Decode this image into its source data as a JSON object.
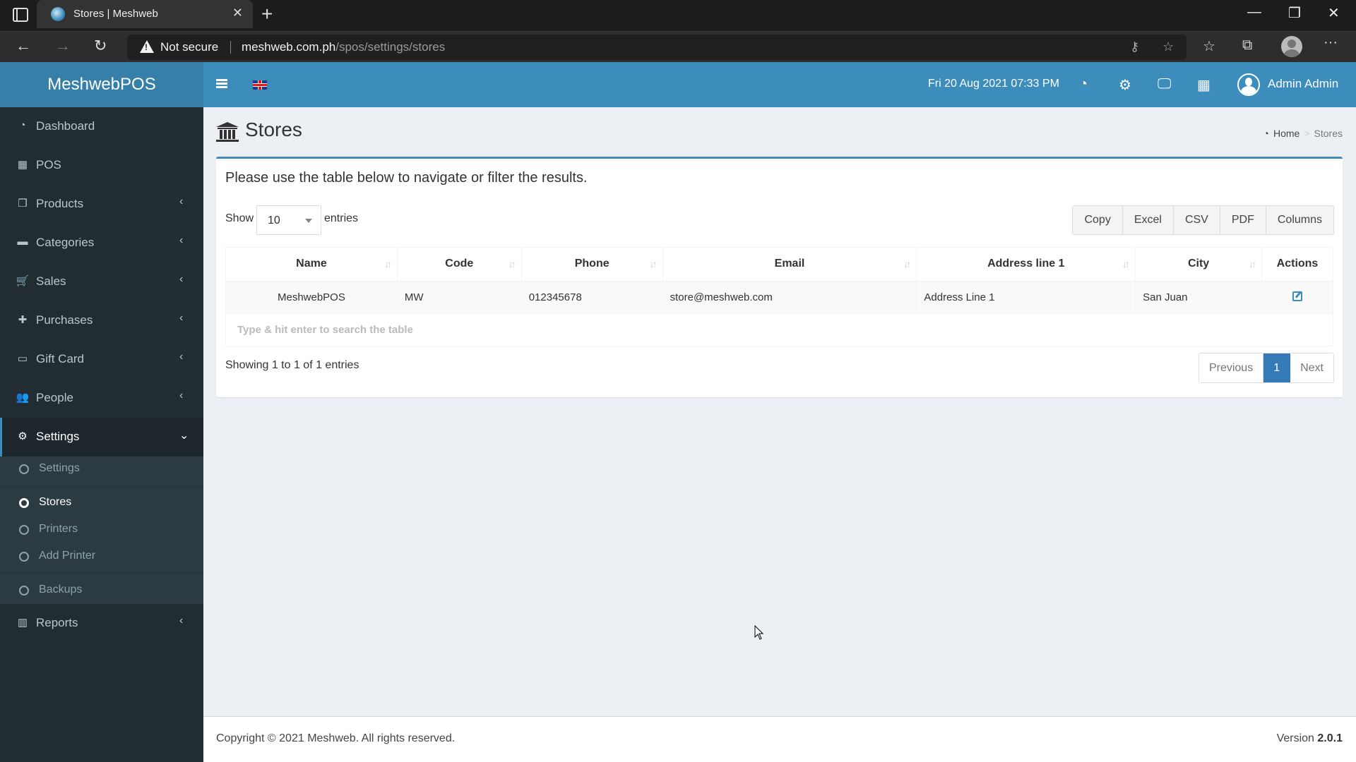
{
  "browser": {
    "tab_title": "Stores | Meshweb",
    "security_label": "Not secure",
    "url_host": "meshweb.com.ph",
    "url_path": "/spos/settings/stores"
  },
  "app": {
    "logo": "MeshwebPOS",
    "datetime": "Fri 20 Aug 2021 07:33 PM",
    "user_name": "Admin Admin",
    "language_flag": "uk-flag",
    "colors": {
      "primary": "#3c8dbc",
      "logo_bg": "#367fa9",
      "sidebar_bg": "#222d32",
      "submenu_bg": "#2c3b41",
      "content_bg": "#ecf0f5",
      "pagination_active": "#337ab7"
    }
  },
  "sidebar": {
    "items": [
      {
        "label": "Dashboard",
        "icon": "dashboard-icon"
      },
      {
        "label": "POS",
        "icon": "grid-icon"
      },
      {
        "label": "Products",
        "icon": "cubes-icon"
      },
      {
        "label": "Categories",
        "icon": "folder-icon"
      },
      {
        "label": "Sales",
        "icon": "cart-icon"
      },
      {
        "label": "Purchases",
        "icon": "plus-icon"
      },
      {
        "label": "Gift Card",
        "icon": "credit-card-icon"
      },
      {
        "label": "People",
        "icon": "users-icon"
      },
      {
        "label": "Settings",
        "icon": "cogs-icon"
      },
      {
        "label": "Reports",
        "icon": "bar-chart-icon"
      }
    ],
    "settings_submenu": [
      {
        "label": "Settings"
      },
      {
        "label": "Stores"
      },
      {
        "label": "Printers"
      },
      {
        "label": "Add Printer"
      },
      {
        "label": "Backups"
      }
    ]
  },
  "page": {
    "title": "Stores",
    "breadcrumb": {
      "home": "Home",
      "current": "Stores"
    },
    "intro": "Please use the table below to navigate or filter the results.",
    "show_label": "Show",
    "entries_label": "entries",
    "page_length": "10",
    "export_buttons": [
      "Copy",
      "Excel",
      "CSV",
      "PDF",
      "Columns"
    ],
    "table": {
      "columns": [
        "Name",
        "Code",
        "Phone",
        "Email",
        "Address line 1",
        "City",
        "Actions"
      ],
      "rows": [
        [
          "MeshwebPOS",
          "MW",
          "012345678",
          "store@meshweb.com",
          "Address Line 1",
          "San Juan",
          ""
        ]
      ],
      "search_placeholder": "Type & hit enter to search the table"
    },
    "info": "Showing 1 to 1 of 1 entries",
    "pagination": {
      "previous": "Previous",
      "current": "1",
      "next": "Next"
    }
  },
  "footer": {
    "copyright": "Copyright © 2021 Meshweb. All rights reserved.",
    "version_label": "Version",
    "version": "2.0.1"
  }
}
